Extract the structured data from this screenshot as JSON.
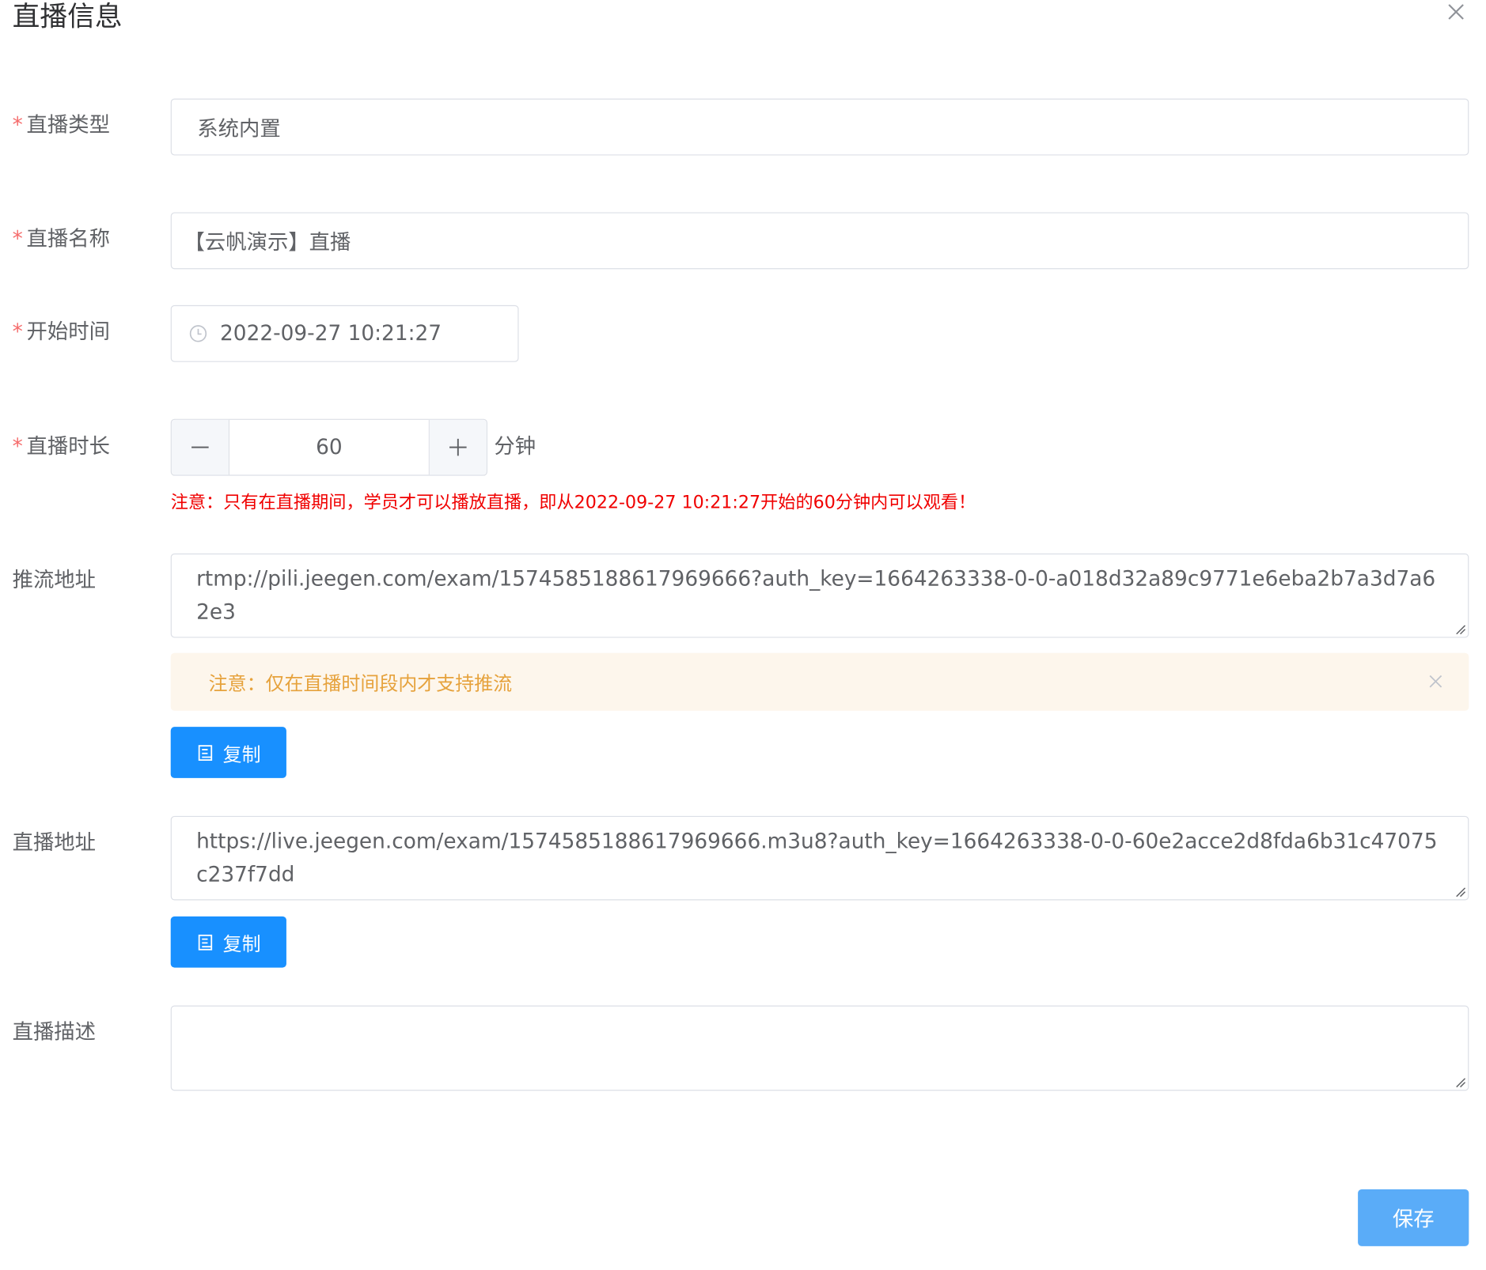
{
  "dialog": {
    "title": "直播信息",
    "close_icon": "close-icon"
  },
  "form": {
    "type": {
      "required_mark": "*",
      "label": "直播类型",
      "value": "系统内置"
    },
    "name": {
      "required_mark": "*",
      "label": "直播名称",
      "value": "【云帆演示】直播"
    },
    "start_time": {
      "required_mark": "*",
      "label": "开始时间",
      "value": "2022-09-27 10:21:27",
      "icon": "clock-icon"
    },
    "duration": {
      "required_mark": "*",
      "label": "直播时长",
      "value": "60",
      "unit": "分钟",
      "minus_icon": "minus-icon",
      "plus_icon": "plus-icon",
      "notice": "注意：只有在直播期间，学员才可以播放直播，即从2022-09-27 10:21:27开始的60分钟内可以观看！"
    },
    "push_url": {
      "label": "推流地址",
      "value": "rtmp://pili.jeegen.com/exam/1574585188617969666?auth_key=1664263338-0-0-a018d32a89c9771e6eba2b7a3d7a62e3",
      "alert_text": "注意：仅在直播时间段内才支持推流",
      "copy_label": "复制"
    },
    "play_url": {
      "label": "直播地址",
      "value": "https://live.jeegen.com/exam/1574585188617969666.m3u8?auth_key=1664263338-0-0-60e2acce2d8fda6b31c47075c237f7dd",
      "copy_label": "复制"
    },
    "description": {
      "label": "直播描述",
      "value": ""
    }
  },
  "footer": {
    "save_label": "保存"
  },
  "colors": {
    "primary": "#1890ff",
    "save_button": "#5aacf8",
    "required": "#f56c6c",
    "notice_red": "#f00000",
    "warning_bg": "#fdf6ec",
    "warning_text": "#e6a23c"
  }
}
